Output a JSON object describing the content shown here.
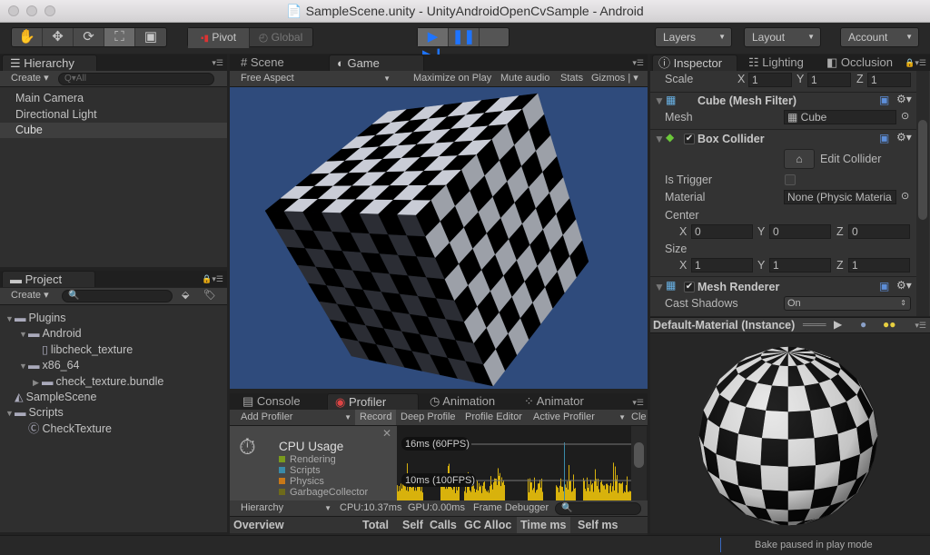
{
  "window": {
    "title": "SampleScene.unity - UnityAndroidOpenCvSample - Android"
  },
  "toolbar": {
    "tools": [
      "hand-icon",
      "move-icon",
      "rotate-icon",
      "scale-icon",
      "rect-icon"
    ],
    "pivot": "Pivot",
    "global": "Global",
    "layers": "Layers",
    "layout": "Layout",
    "account": "Account"
  },
  "hierarchy": {
    "tab": "Hierarchy",
    "create": "Create",
    "search_placeholder": "Q▾All",
    "items": [
      "Main Camera",
      "Directional Light",
      "Cube"
    ],
    "selected": "Cube"
  },
  "project": {
    "tab": "Project",
    "create": "Create",
    "items": [
      "Plugins",
      "Android",
      "libcheck_texture",
      "x86_64",
      "check_texture.bundle",
      "SampleScene",
      "Scripts",
      "CheckTexture"
    ]
  },
  "game": {
    "tabs": [
      "Scene",
      "Game"
    ],
    "aspect": "Free Aspect",
    "buttons": [
      "Maximize on Play",
      "Mute audio",
      "Stats",
      "Gizmos"
    ],
    "background": "#2f4b7c"
  },
  "bottom": {
    "tabs": [
      "Console",
      "Profiler",
      "Animation",
      "Animator"
    ],
    "toolbar": [
      "Add Profiler",
      "Record",
      "Deep Profile",
      "Profile Editor",
      "Active Profiler",
      "Cle"
    ],
    "cpu": {
      "title": "CPU Usage",
      "legend": [
        {
          "name": "Rendering",
          "color": "#7a9a1e"
        },
        {
          "name": "Scripts",
          "color": "#3a8aa8"
        },
        {
          "name": "Physics",
          "color": "#c87818"
        },
        {
          "name": "GarbageCollector",
          "color": "#6e6a1a"
        }
      ],
      "line16": "16ms (60FPS)",
      "line10": "10ms (100FPS)",
      "bar_color": "#d8b20c"
    },
    "status": {
      "view": "Hierarchy",
      "cpu": "CPU:10.37ms",
      "gpu": "GPU:0.00ms",
      "frame_debugger": "Frame Debugger"
    },
    "columns": [
      "Overview",
      "Total",
      "Self",
      "Calls",
      "GC Alloc",
      "Time ms",
      "Self ms"
    ]
  },
  "inspector": {
    "tabs": [
      "Inspector",
      "Lighting",
      "Occlusion"
    ],
    "scale": {
      "label": "Scale",
      "x": "1",
      "y": "1",
      "z": "1"
    },
    "mesh_filter": {
      "title": "Cube (Mesh Filter)",
      "mesh_label": "Mesh",
      "mesh_value": "Cube"
    },
    "box_collider": {
      "title": "Box Collider",
      "enabled": true,
      "edit": "Edit Collider",
      "is_trigger_label": "Is Trigger",
      "is_trigger": false,
      "material_label": "Material",
      "material_value": "None (Physic Materia",
      "center_label": "Center",
      "center": {
        "x": "0",
        "y": "0",
        "z": "0"
      },
      "size_label": "Size",
      "size": {
        "x": "1",
        "y": "1",
        "z": "1"
      }
    },
    "mesh_renderer": {
      "title": "Mesh Renderer",
      "enabled": true,
      "cast_shadows_label": "Cast Shadows",
      "cast_shadows": "On"
    },
    "preview": {
      "title": "Default-Material (Instance)"
    }
  },
  "statusbar": {
    "message": "Bake paused in play mode"
  }
}
